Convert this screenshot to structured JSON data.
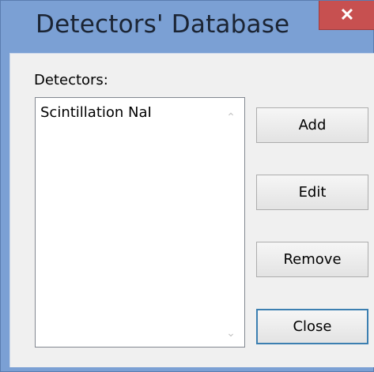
{
  "window": {
    "title": "Detectors' Database",
    "close_glyph": "✕"
  },
  "detectors": {
    "label": "Detectors:",
    "items": [
      "Scintillation NaI"
    ],
    "scroll_up_glyph": "⌃",
    "scroll_down_glyph": "⌄"
  },
  "buttons": {
    "add": "Add",
    "edit": "Edit",
    "remove": "Remove",
    "close": "Close"
  },
  "icons": {
    "close": "close-icon",
    "scroll_up": "chevron-up-icon",
    "scroll_down": "chevron-down-icon"
  },
  "colors": {
    "titlebar": "#7ba0d4",
    "close_button": "#c75050",
    "dialog_body": "#f0f0f0",
    "default_button_border": "#3c7fb1"
  }
}
